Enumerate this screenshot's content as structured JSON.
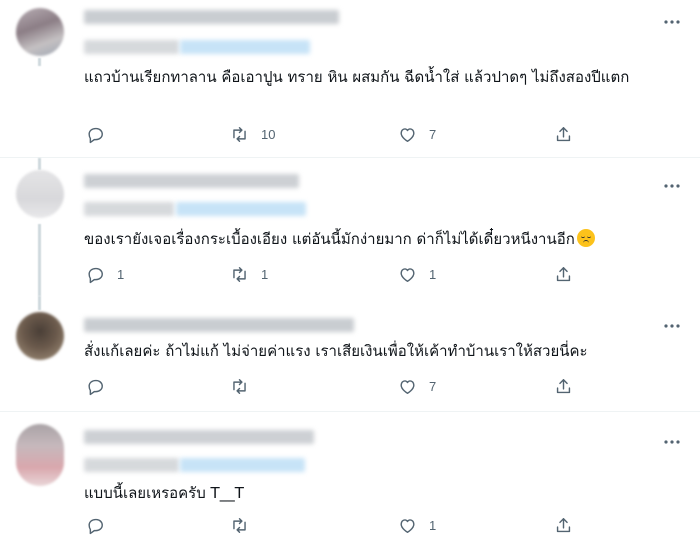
{
  "tweets": [
    {
      "text": "แถวบ้านเรียกทาลาน คือเอาปูน ทราย หิน ผสมกัน ฉีดน้ำใส่ แล้วปาดๆ ไม่ถึงสองปีแตก",
      "reply_count": "",
      "retweet_count": "10",
      "like_count": "7"
    },
    {
      "text": "ของเรายังเจอเรื่องกระเบื้องเอียง แต่อันนี้มักง่ายมาก ด่าก็ไม่ได้เดี๋ยวหนีงานอีก",
      "emoji": "disappointed-face-emoji",
      "reply_count": "1",
      "retweet_count": "1",
      "like_count": "1"
    },
    {
      "text": "สั่งแก้เลยค่ะ ถ้าไม่แก้ ไม่จ่ายค่าแรง เราเสียเงินเพื่อให้เค้าทำบ้านเราให้สวยนี่คะ",
      "reply_count": "",
      "retweet_count": "",
      "like_count": "7"
    },
    {
      "text": "แบบนี้เลยเหรอครับ T__T",
      "reply_count": "",
      "retweet_count": "",
      "like_count": "1"
    }
  ],
  "icons": {
    "more": "more-horizontal-icon",
    "reply": "reply-icon",
    "retweet": "retweet-icon",
    "like": "heart-icon",
    "share": "share-icon"
  },
  "colors": {
    "text": "#0f1419",
    "secondary": "#536471",
    "divider": "#eff3f4",
    "link_blurred": "#c7e3f7"
  }
}
